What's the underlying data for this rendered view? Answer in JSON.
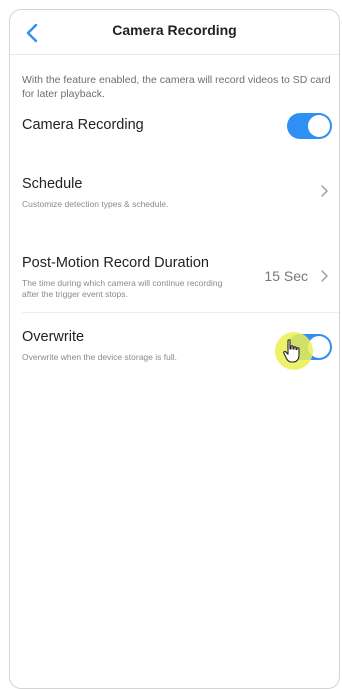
{
  "nav": {
    "back_icon": "chevron-left-icon",
    "title": "Camera Recording"
  },
  "description": "With the feature enabled, the camera will record videos to SD card for later playback.",
  "rows": {
    "camera_recording": {
      "label": "Camera Recording",
      "enabled": true
    },
    "schedule": {
      "label": "Schedule",
      "subtitle": "Customize detection types & schedule."
    },
    "post_motion": {
      "label": "Post-Motion Record Duration",
      "subtitle": "The time during which camera will continue recording after the trigger event stops.",
      "value": "15 Sec"
    },
    "overwrite": {
      "label": "Overwrite",
      "subtitle": "Overwrite when the device storage is full.",
      "enabled": true
    }
  },
  "colors": {
    "accent": "#2f8ff4",
    "cursor_highlight": "#ebf050"
  },
  "icons": {
    "chevron": "chevron-right-icon",
    "cursor": "hand-pointer-icon"
  }
}
